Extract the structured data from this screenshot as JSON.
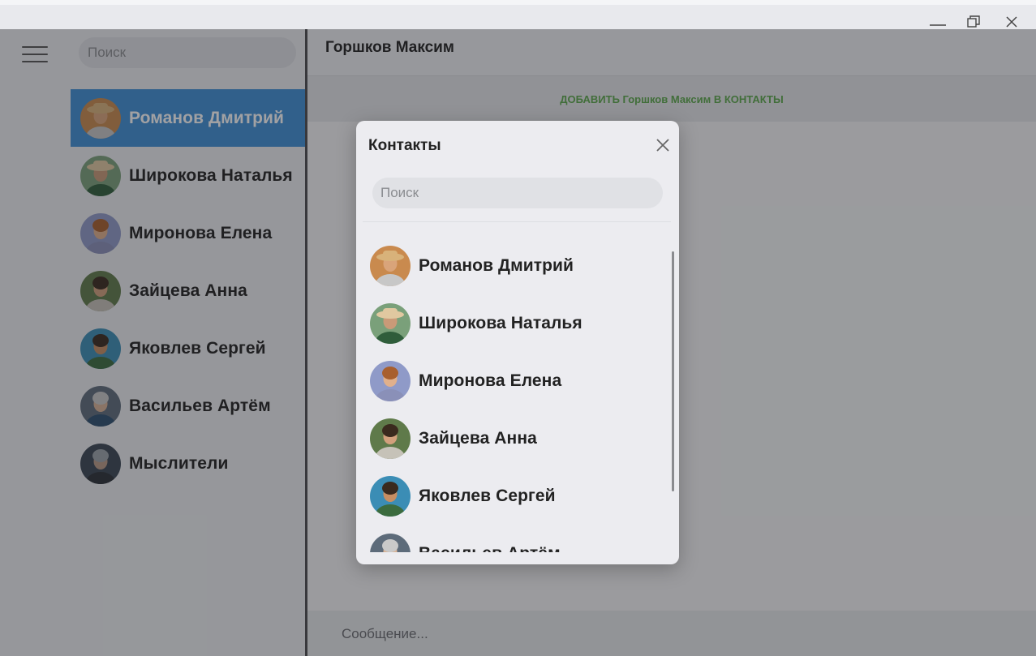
{
  "window": {
    "controls": [
      "minimize-icon",
      "restore-icon",
      "close-icon"
    ]
  },
  "sidebar": {
    "menu_icon": "hamburger-icon",
    "search_placeholder": "Поиск",
    "chats": [
      {
        "name": "Романов Дмитрий",
        "active": true
      },
      {
        "name": "Широкова Наталья",
        "active": false
      },
      {
        "name": "Миронова Елена",
        "active": false
      },
      {
        "name": "Зайцева Анна",
        "active": false
      },
      {
        "name": "Яковлев Сергей",
        "active": false
      },
      {
        "name": "Васильев Артём",
        "active": false
      },
      {
        "name": "Мыслители",
        "active": false
      }
    ]
  },
  "conversation": {
    "title": "Горшков Максим",
    "add_contact_link": "ДОБАВИТЬ Горшков Максим В КОНТАКТЫ",
    "message_placeholder": "Сообщение..."
  },
  "modal": {
    "title": "Контакты",
    "search_placeholder": "Поиск",
    "contacts": [
      {
        "name": "Романов Дмитрий"
      },
      {
        "name": "Широкова Наталья"
      },
      {
        "name": "Миронова Елена"
      },
      {
        "name": "Зайцева Анна"
      },
      {
        "name": "Яковлев Сергей"
      },
      {
        "name": "Васильев Артём"
      }
    ]
  },
  "colors": {
    "accent": "#3f8fd6",
    "add_link": "#5ba84a"
  }
}
